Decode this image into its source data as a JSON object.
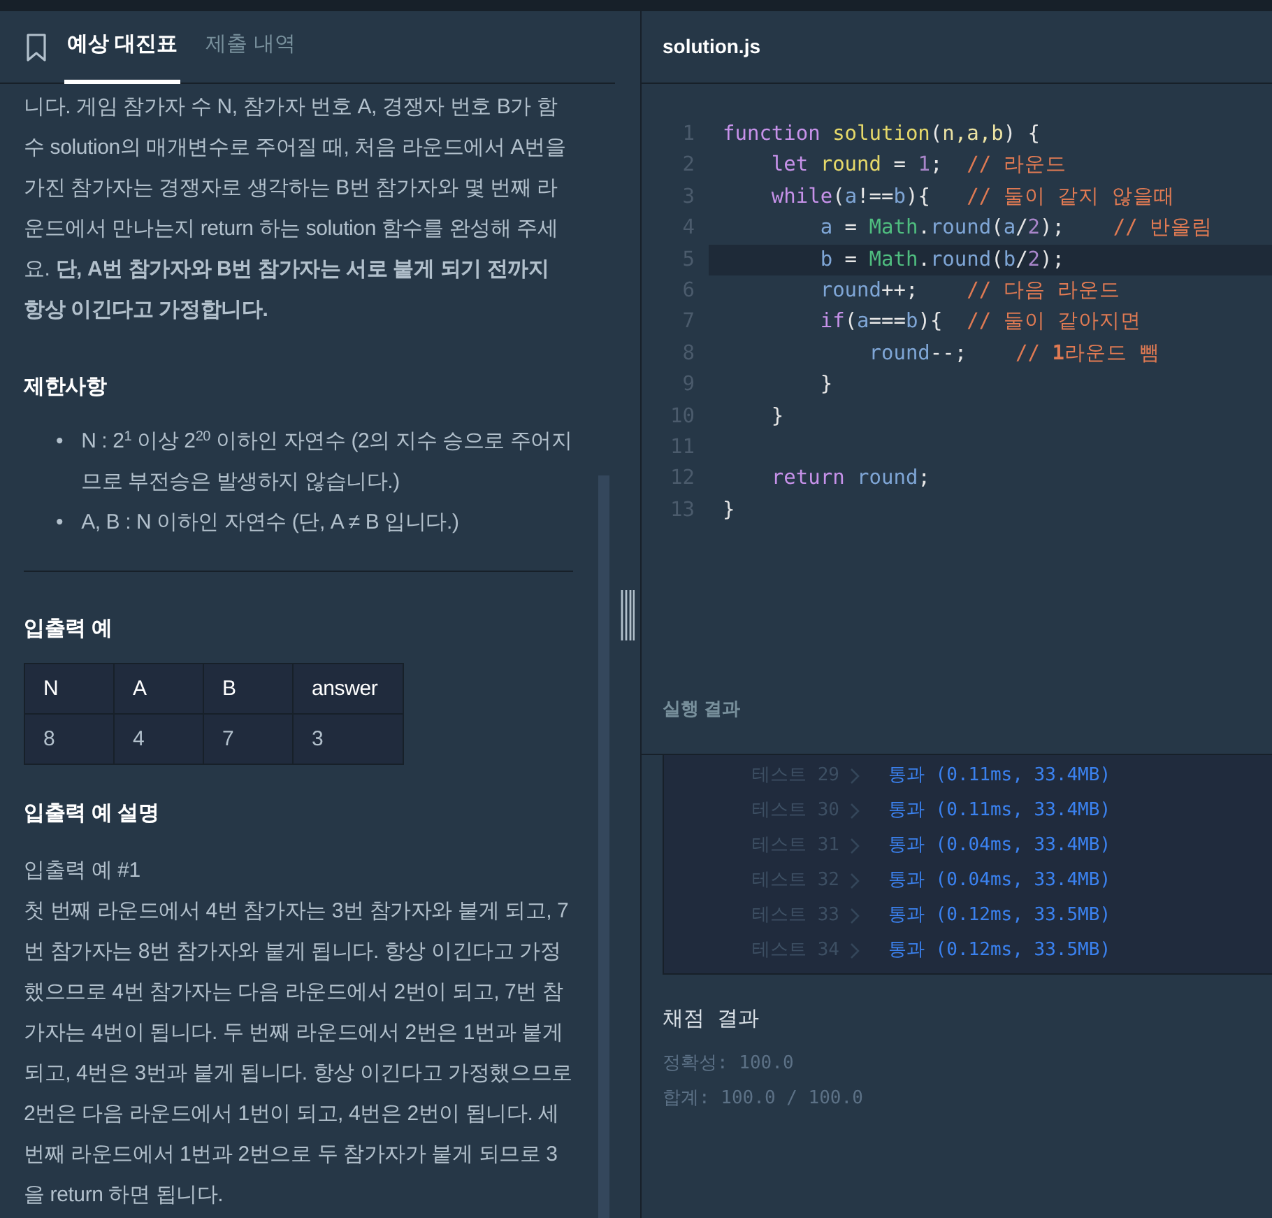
{
  "tabs": [
    {
      "label": "예상 대진표",
      "selected": true
    },
    {
      "label": "제출 내역",
      "selected": false
    }
  ],
  "problem": {
    "intro": "니다. 게임 참가자 수 N, 참가자 번호 A, 경쟁자 번호 B가 함수 solution의 매개변수로 주어질 때, 처음 라운드에서 A번을 가진 참가자는 경쟁자로 생각하는 B번 참가자와 몇 번째 라운드에서 만나는지 return 하는 solution 함수를 완성해 주세요. **단, A번 참가자와 B번 참가자는 서로 붙게 되기 전까지 항상 이긴다고 가정합니다.**",
    "constraints_title": "제한사항",
    "constraints": [
      {
        "marker": "•",
        "text": "N : 2$^{1}$ 이상 2$^{20}$ 이하인 자연수 (2의 지수 승으로 주어지므로 부전승은 발생하지 않습니다.)"
      },
      {
        "marker": "•",
        "text": "A, B : N 이하인 자연수 (단, A ≠ B 입니다.)"
      }
    ],
    "examples_title": "입출력 예",
    "table": {
      "columns": [
        "N",
        "A",
        "B",
        "answer"
      ],
      "rows": [
        [
          "8",
          "4",
          "7",
          "3"
        ]
      ]
    },
    "explanation_title": "입출력 예 설명",
    "explanation_subtitle": "입출력 예 #1",
    "explanation": "첫 번째 라운드에서 4번 참가자는 3번 참가자와 붙게 되고, 7번 참가자는 8번 참가자와 붙게 됩니다. 항상 이긴다고 가정했으므로 4번 참가자는 다음 라운드에서 2번이 되고, 7번 참가자는 4번이 됩니다. 두 번째 라운드에서 2번은 1번과 붙게 되고, 4번은 3번과 붙게 됩니다. 항상 이긴다고 가정했으므로 2번은 다음 라운드에서 1번이 되고, 4번은 2번이 됩니다. 세 번째 라운드에서 1번과 2번으로 두 참가자가 붙게 되므로 3을 return 하면 됩니다."
  },
  "editor": {
    "filename": "solution.js",
    "lines": [
      {
        "number": "1",
        "highlighted": false,
        "tokens": [
          {
            "t": "function ",
            "kind": "kw"
          },
          {
            "t": "solution",
            "kind": "fn"
          },
          {
            "t": "(",
            "kind": "op"
          },
          {
            "t": "n,a,b",
            "kind": "param"
          },
          {
            "t": ") {",
            "kind": "op"
          }
        ]
      },
      {
        "number": "2",
        "highlighted": false,
        "tokens": [
          {
            "t": "    let ",
            "kind": "kw"
          },
          {
            "t": "round",
            "kind": "fn"
          },
          {
            "t": " = ",
            "kind": "op"
          },
          {
            "t": "1",
            "kind": "num"
          },
          {
            "t": ";  ",
            "kind": "op"
          },
          {
            "t": "// 라운드",
            "kind": "comment"
          }
        ]
      },
      {
        "number": "3",
        "highlighted": false,
        "tokens": [
          {
            "t": "    while",
            "kind": "kw"
          },
          {
            "t": "(",
            "kind": "op"
          },
          {
            "t": "a",
            "kind": "var"
          },
          {
            "t": "!==",
            "kind": "op"
          },
          {
            "t": "b",
            "kind": "var"
          },
          {
            "t": "){   ",
            "kind": "op"
          },
          {
            "t": "// 둘이 같지 않을때",
            "kind": "comment"
          }
        ]
      },
      {
        "number": "4",
        "highlighted": false,
        "tokens": [
          {
            "t": "        a",
            "kind": "var"
          },
          {
            "t": " = ",
            "kind": "op"
          },
          {
            "t": "Math",
            "kind": "class"
          },
          {
            "t": ".",
            "kind": "op"
          },
          {
            "t": "round",
            "kind": "var"
          },
          {
            "t": "(",
            "kind": "op"
          },
          {
            "t": "a",
            "kind": "var"
          },
          {
            "t": "/",
            "kind": "op"
          },
          {
            "t": "2",
            "kind": "num"
          },
          {
            "t": ");    ",
            "kind": "op"
          },
          {
            "t": "// 반올림",
            "kind": "comment"
          }
        ]
      },
      {
        "number": "5",
        "highlighted": true,
        "tokens": [
          {
            "t": "        b",
            "kind": "var"
          },
          {
            "t": " = ",
            "kind": "op"
          },
          {
            "t": "Math",
            "kind": "class"
          },
          {
            "t": ".",
            "kind": "op"
          },
          {
            "t": "round",
            "kind": "var"
          },
          {
            "t": "(",
            "kind": "op"
          },
          {
            "t": "b",
            "kind": "var"
          },
          {
            "t": "/",
            "kind": "op"
          },
          {
            "t": "2",
            "kind": "num"
          },
          {
            "t": ");",
            "kind": "op"
          }
        ]
      },
      {
        "number": "6",
        "highlighted": false,
        "tokens": [
          {
            "t": "        round",
            "kind": "var"
          },
          {
            "t": "++;    ",
            "kind": "op"
          },
          {
            "t": "// 다음 라운드",
            "kind": "comment"
          }
        ]
      },
      {
        "number": "7",
        "highlighted": false,
        "tokens": [
          {
            "t": "        if",
            "kind": "kw"
          },
          {
            "t": "(",
            "kind": "op"
          },
          {
            "t": "a",
            "kind": "var"
          },
          {
            "t": "===",
            "kind": "op"
          },
          {
            "t": "b",
            "kind": "var"
          },
          {
            "t": "){  ",
            "kind": "op"
          },
          {
            "t": "// 둘이 같아지면",
            "kind": "comment"
          }
        ]
      },
      {
        "number": "8",
        "highlighted": false,
        "tokens": [
          {
            "t": "            round",
            "kind": "var"
          },
          {
            "t": "--;    ",
            "kind": "op"
          },
          {
            "t": "// ",
            "kind": "comment"
          },
          {
            "t": "1",
            "kind": "comment-num"
          },
          {
            "t": "라운드 뺌",
            "kind": "comment"
          }
        ]
      },
      {
        "number": "9",
        "highlighted": false,
        "tokens": [
          {
            "t": "        }",
            "kind": "op"
          }
        ]
      },
      {
        "number": "10",
        "highlighted": false,
        "tokens": [
          {
            "t": "    }",
            "kind": "op"
          }
        ]
      },
      {
        "number": "11",
        "highlighted": false
      },
      {
        "number": "12",
        "highlighted": false,
        "tokens": [
          {
            "t": "    return ",
            "kind": "kw"
          },
          {
            "t": "round",
            "kind": "var"
          },
          {
            "t": ";",
            "kind": "op"
          }
        ]
      },
      {
        "number": "13",
        "highlighted": false,
        "tokens": [
          {
            "t": "}",
            "kind": "op"
          }
        ]
      }
    ]
  },
  "results": {
    "title": "실행 결과",
    "tests": [
      {
        "label": "테스트 29",
        "passed": true,
        "status": "통과",
        "detail": "(0.11ms, 33.4MB)"
      },
      {
        "label": "테스트 30",
        "passed": true,
        "status": "통과",
        "detail": "(0.11ms, 33.4MB)"
      },
      {
        "label": "테스트 31",
        "passed": true,
        "status": "통과",
        "detail": "(0.04ms, 33.4MB)"
      },
      {
        "label": "테스트 32",
        "passed": true,
        "status": "통과",
        "detail": "(0.04ms, 33.4MB)"
      },
      {
        "label": "테스트 33",
        "passed": true,
        "status": "통과",
        "detail": "(0.12ms, 33.5MB)"
      },
      {
        "label": "테스트 34",
        "passed": true,
        "status": "통과",
        "detail": "(0.12ms, 33.5MB)"
      }
    ],
    "score_title": "채점 결과",
    "score_lines": [
      "정확성: 100.0",
      "합계: 100.0 / 100.0"
    ]
  }
}
